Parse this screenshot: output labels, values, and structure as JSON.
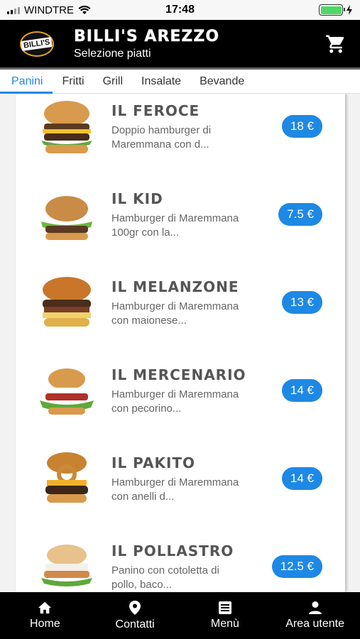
{
  "status": {
    "carrier": "WINDTRE",
    "time": "17:48"
  },
  "header": {
    "title": "BILLI'S AREZZO",
    "subtitle": "Selezione piatti",
    "logo_text": "BILLI'S"
  },
  "tabs": [
    {
      "label": "Panini",
      "active": true
    },
    {
      "label": "Fritti",
      "active": false
    },
    {
      "label": "Grill",
      "active": false
    },
    {
      "label": "Insalate",
      "active": false
    },
    {
      "label": "Bevande",
      "active": false
    }
  ],
  "items": [
    {
      "name": "IL FEROCE",
      "desc_line1": "Doppio hamburger di",
      "desc_line2": "Maremmana con d...",
      "price": "18 €"
    },
    {
      "name": "IL KID",
      "desc_line1": "Hamburger di Maremmana",
      "desc_line2": "100gr con la...",
      "price": "7.5 €"
    },
    {
      "name": "IL MELANZONE",
      "desc_line1": "Hamburger di Maremmana",
      "desc_line2": "con maionese...",
      "price": "13 €"
    },
    {
      "name": "IL MERCENARIO",
      "desc_line1": "Hamburger di Maremmana",
      "desc_line2": "con pecorino...",
      "price": "14 €"
    },
    {
      "name": "IL PAKITO",
      "desc_line1": "Hamburger di Maremmana",
      "desc_line2": "con anelli d...",
      "price": "14 €"
    },
    {
      "name": "IL POLLASTRO",
      "desc_line1": "Panino con cotoletta di",
      "desc_line2": "pollo, baco...",
      "price": "12.5 €"
    }
  ],
  "bottom_nav": [
    {
      "label": "Home",
      "icon": "home-icon"
    },
    {
      "label": "Contatti",
      "icon": "location-pin-icon"
    },
    {
      "label": "Menù",
      "icon": "menu-list-icon"
    },
    {
      "label": "Area utente",
      "icon": "user-icon"
    }
  ],
  "colors": {
    "accent": "#1e88e5",
    "header_bg": "#000000",
    "battery": "#4cd964"
  }
}
